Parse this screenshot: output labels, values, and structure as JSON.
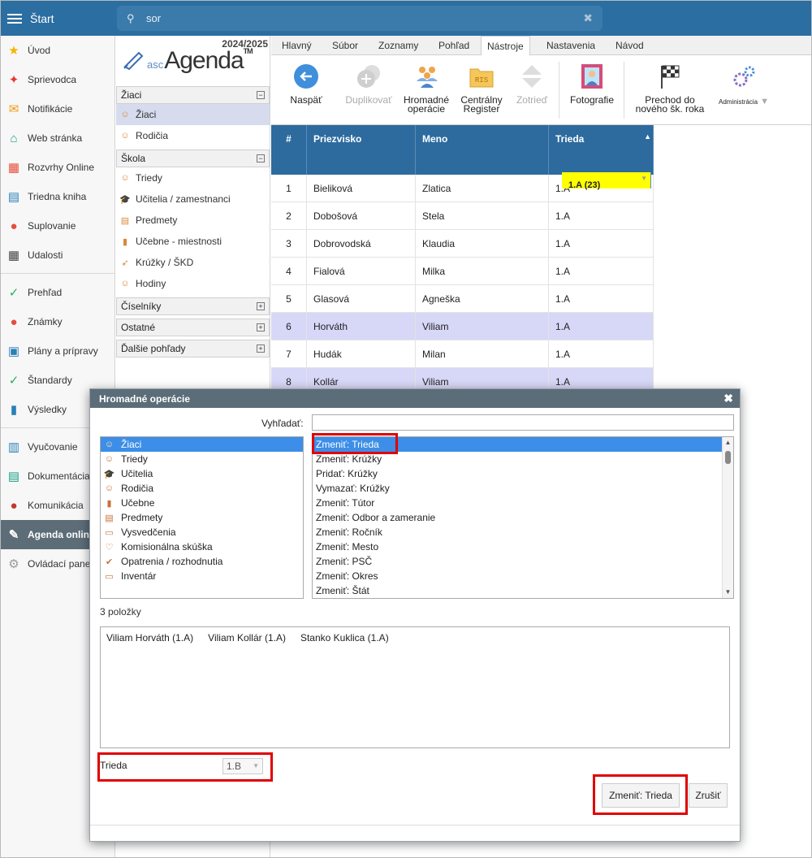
{
  "topbar": {
    "start_label": "Štart",
    "search_value": "sor"
  },
  "nav": [
    {
      "label": "Úvod",
      "icon": "star-icon",
      "color": "#f5b400",
      "glyph": "★"
    },
    {
      "label": "Sprievodca",
      "icon": "wand-icon",
      "color": "#e53935",
      "glyph": "✦"
    },
    {
      "label": "Notifikácie",
      "icon": "envelope-icon",
      "color": "#f39c12",
      "glyph": "✉"
    },
    {
      "label": "Web stránka",
      "icon": "home-icon",
      "color": "#16a085",
      "glyph": "⌂"
    },
    {
      "label": "Rozvrhy Online",
      "icon": "grid-icon",
      "color": "#e74c3c",
      "glyph": "▦"
    },
    {
      "label": "Triedna kniha",
      "icon": "book-icon",
      "color": "#2980b9",
      "glyph": "▤"
    },
    {
      "label": "Suplovanie",
      "icon": "person-icon",
      "color": "#e74c3c",
      "glyph": "●"
    },
    {
      "label": "Udalosti",
      "icon": "calendar-icon",
      "color": "#444444",
      "glyph": "▦"
    },
    {
      "label": "Prehľad",
      "icon": "check-circle-icon",
      "color": "#27ae60",
      "glyph": "✓"
    },
    {
      "label": "Známky",
      "icon": "grade-icon",
      "color": "#e74c3c",
      "glyph": "●"
    },
    {
      "label": "Plány a prípravy",
      "icon": "briefcase-icon",
      "color": "#2980b9",
      "glyph": "▣"
    },
    {
      "label": "Štandardy",
      "icon": "shield-icon",
      "color": "#27ae60",
      "glyph": "✓"
    },
    {
      "label": "Výsledky",
      "icon": "bar-chart-icon",
      "color": "#2980b9",
      "glyph": "▮"
    },
    {
      "label": "Vyučovanie",
      "icon": "open-book-icon",
      "color": "#2980b9",
      "glyph": "▥"
    },
    {
      "label": "Dokumentácia",
      "icon": "document-icon",
      "color": "#16a085",
      "glyph": "▤"
    },
    {
      "label": "Komunikácia",
      "icon": "chat-icon",
      "color": "#c0392b",
      "glyph": "●"
    },
    {
      "label": "Agenda online",
      "icon": "agenda-icon",
      "color": "#5d6d78",
      "glyph": "✎"
    },
    {
      "label": "Ovládací panel",
      "icon": "gear-icon",
      "color": "#999999",
      "glyph": "⚙"
    }
  ],
  "tree": {
    "year": "2024/2025",
    "logo_small": "asc",
    "logo_big": "Agenda",
    "logo_tm": "TM",
    "groups": [
      {
        "label": "Žiaci",
        "toggle": "−",
        "items": [
          {
            "label": "Žiaci",
            "icon": "student-icon",
            "glyph": "☺",
            "sel": true
          },
          {
            "label": "Rodičia",
            "icon": "parents-icon",
            "glyph": "☺"
          }
        ]
      },
      {
        "label": "Škola",
        "toggle": "−",
        "items": [
          {
            "label": "Triedy",
            "icon": "class-icon",
            "glyph": "☺"
          },
          {
            "label": "Učitelia / zamestnanci",
            "icon": "graduation-cap-icon",
            "glyph": "🎓"
          },
          {
            "label": "Predmety",
            "icon": "subject-icon",
            "glyph": "▤"
          },
          {
            "label": "Učebne - miestnosti",
            "icon": "door-icon",
            "glyph": "▮"
          },
          {
            "label": "Krúžky / ŠKD",
            "icon": "rocket-icon",
            "glyph": "➶"
          },
          {
            "label": "Hodiny",
            "icon": "lessons-icon",
            "glyph": "☺"
          }
        ]
      },
      {
        "label": "Číselníky",
        "toggle": "+",
        "items": []
      },
      {
        "label": "Ostatné",
        "toggle": "+",
        "items": []
      },
      {
        "label": "Ďalšie pohľady",
        "toggle": "+",
        "items": []
      }
    ]
  },
  "tabs": [
    "Hlavný",
    "Súbor",
    "Zoznamy",
    "Pohľad",
    "Nástroje",
    "Nastavenia",
    "Návod"
  ],
  "active_tab": "Nástroje",
  "ribbon": {
    "back": "Naspäť",
    "duplicate": "Duplikovať",
    "bulk1": "Hromadné",
    "bulk2": "operácie",
    "ris1": "Centrálny",
    "ris2": "Register",
    "ris_icon": "RIS",
    "sort": "Zotrieď",
    "photos": "Fotografie",
    "trans1": "Prechod do",
    "trans2": "nového šk. roka",
    "admin": "Administrácia"
  },
  "table": {
    "headers": [
      "#",
      "Priezvisko",
      "Meno",
      "Trieda"
    ],
    "filter": "1.A (23)",
    "rows": [
      [
        "1",
        "Bieliková",
        "Zlatica",
        "1.A"
      ],
      [
        "2",
        "Dobošová",
        "Stela",
        "1.A"
      ],
      [
        "3",
        "Dobrovodská",
        "Klaudia",
        "1.A"
      ],
      [
        "4",
        "Fialová",
        "Milka",
        "1.A"
      ],
      [
        "5",
        "Glasová",
        "Agneška",
        "1.A"
      ],
      [
        "6",
        "Horváth",
        "Viliam",
        "1.A"
      ],
      [
        "7",
        "Hudák",
        "Milan",
        "1.A"
      ],
      [
        "8",
        "Kollár",
        "Viliam",
        "1.A"
      ]
    ],
    "highlighted_rows": [
      6,
      8
    ]
  },
  "dialog": {
    "title": "Hromadné operácie",
    "search_label": "Vyhľadať:",
    "search_value": "",
    "left_list": [
      {
        "label": "Žiaci",
        "icon": "student-icon",
        "glyph": "☺"
      },
      {
        "label": "Triedy",
        "icon": "class-icon",
        "glyph": "☺"
      },
      {
        "label": "Učitelia",
        "icon": "graduation-cap-icon",
        "glyph": "🎓"
      },
      {
        "label": "Rodičia",
        "icon": "parents-icon",
        "glyph": "☺"
      },
      {
        "label": "Učebne",
        "icon": "door-icon",
        "glyph": "▮"
      },
      {
        "label": "Predmety",
        "icon": "subject-icon",
        "glyph": "▤"
      },
      {
        "label": "Vysvedčenia",
        "icon": "certificate-icon",
        "glyph": "▭"
      },
      {
        "label": "Komisionálna skúška",
        "icon": "heart-icon",
        "glyph": "♡"
      },
      {
        "label": "Opatrenia / rozhodnutia",
        "icon": "pin-icon",
        "glyph": "✔"
      },
      {
        "label": "Inventár",
        "icon": "computer-icon",
        "glyph": "▭"
      }
    ],
    "right_list": [
      "Zmeniť: Trieda",
      "Zmeniť: Krúžky",
      "Pridať: Krúžky",
      "Vymazať: Krúžky",
      "Zmeniť: Tútor",
      "Zmeniť: Odbor a zameranie",
      "Zmeniť: Ročník",
      "Zmeniť: Mesto",
      "Zmeniť: PSČ",
      "Zmeniť: Okres",
      "Zmeniť: Štát"
    ],
    "count": "3 položky",
    "selected": [
      "Viliam Horváth (1.A)",
      "Viliam Kollár (1.A)",
      "Stanko Kuklica (1.A)"
    ],
    "field_label": "Trieda",
    "field_value": "1.B",
    "ok": "Zmeniť: Trieda",
    "cancel": "Zrušiť"
  }
}
